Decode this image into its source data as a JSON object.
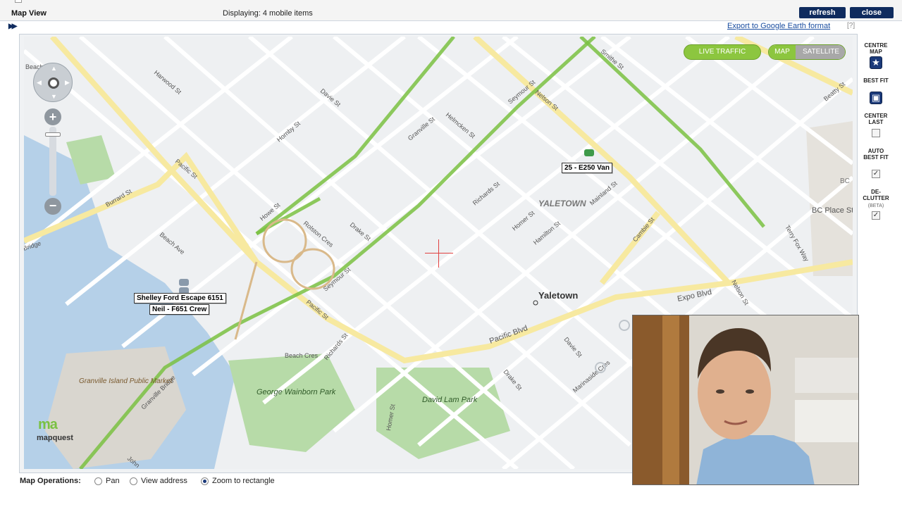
{
  "window": {
    "title": "Map View",
    "displaying": "Displaying: 4 mobile items",
    "refresh_label": "refresh",
    "close_label": "close"
  },
  "toolbar": {
    "export_label": "Export to Google Earth format",
    "help_label": "[?]"
  },
  "map_controls": {
    "live_traffic": "LIVE TRAFFIC",
    "map": "MAP",
    "satellite": "SATELLITE",
    "zoom_in": "+",
    "zoom_out": "−"
  },
  "sidebar": {
    "centre_map": "CENTRE MAP",
    "best_fit": "BEST FIT",
    "center_last": "CENTER LAST",
    "auto_best_fit": "AUTO BEST FIT",
    "declutter": "DE-CLUTTER",
    "beta": "(BETA)",
    "center_last_checked": false,
    "auto_best_fit_checked": true,
    "declutter_checked": true
  },
  "vehicles": [
    {
      "label": "25 - E250 Van"
    },
    {
      "label": "Shelley Ford Escape 6151"
    },
    {
      "label": "Neil - F651 Crew"
    }
  ],
  "map_labels": {
    "area_yaletown_caps": "YALETOWN",
    "area_yaletown": "Yaletown",
    "stadium": "BC Place Stadium",
    "bc": "BC",
    "park1": "George Wainborn Park",
    "park2": "David Lam Park",
    "market": "Granville Island Public Market",
    "streets": {
      "burrard": "Burrard St",
      "pacific_st": "Pacific St",
      "howe": "Howe St",
      "seymour": "Seymour St",
      "granville": "Granville St",
      "richards": "Richards St",
      "homer": "Homer St",
      "hamilton": "Hamilton St",
      "mainland": "Mainland St",
      "cambie": "Cambie St",
      "nelson": "Nelson St",
      "smithe": "Smithe St",
      "beatty": "Beatty St",
      "hornby": "Hornby St",
      "davie": "Davie St",
      "harwood": "Harwood St",
      "drake": "Drake St",
      "helmcken": "Helmcken St",
      "pacific_blvd": "Pacific Blvd",
      "expo": "Expo Blvd",
      "terry_fox": "Terry Fox Way",
      "beach_ave": "Beach Ave",
      "beach_cres": "Beach Cres",
      "rolston": "Rolston Cres",
      "granville_bridge": "Granville Bridge",
      "marinaside": "Marinaside Cres",
      "beach_ave2": "Beach Ave",
      "bridge": "Bridge",
      "beach": "Beach",
      "john": "John"
    }
  },
  "logo": {
    "mark": "ma",
    "text": "mapquest"
  },
  "operations": {
    "label": "Map Operations:",
    "options": [
      "Pan",
      "View address",
      "Zoom to rectangle"
    ],
    "selected": "Zoom to rectangle"
  },
  "colors": {
    "nav_button": "#0f2b5e",
    "traffic_green": "#8cc63f",
    "road_yellow": "#f7e9a0",
    "park_green": "#b7dba8",
    "water_blue": "#b5d0e8"
  }
}
